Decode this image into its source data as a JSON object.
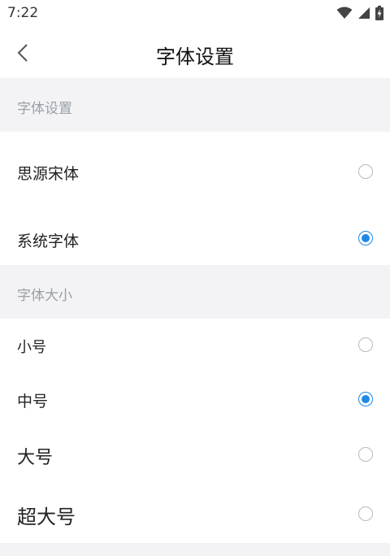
{
  "status_bar": {
    "time": "7:22"
  },
  "header": {
    "title": "字体设置"
  },
  "font_family_section": {
    "header": "字体设置",
    "options": [
      {
        "label": "思源宋体",
        "selected": false
      },
      {
        "label": "系统字体",
        "selected": true
      }
    ]
  },
  "font_size_section": {
    "header": "字体大小",
    "options": [
      {
        "label": "小号",
        "selected": false
      },
      {
        "label": "中号",
        "selected": true
      },
      {
        "label": "大号",
        "selected": false
      },
      {
        "label": "超大号",
        "selected": false
      }
    ]
  },
  "colors": {
    "accent": "#1e88e5",
    "section_bg": "#f3f3f5",
    "section_text": "#9aa0a8"
  }
}
